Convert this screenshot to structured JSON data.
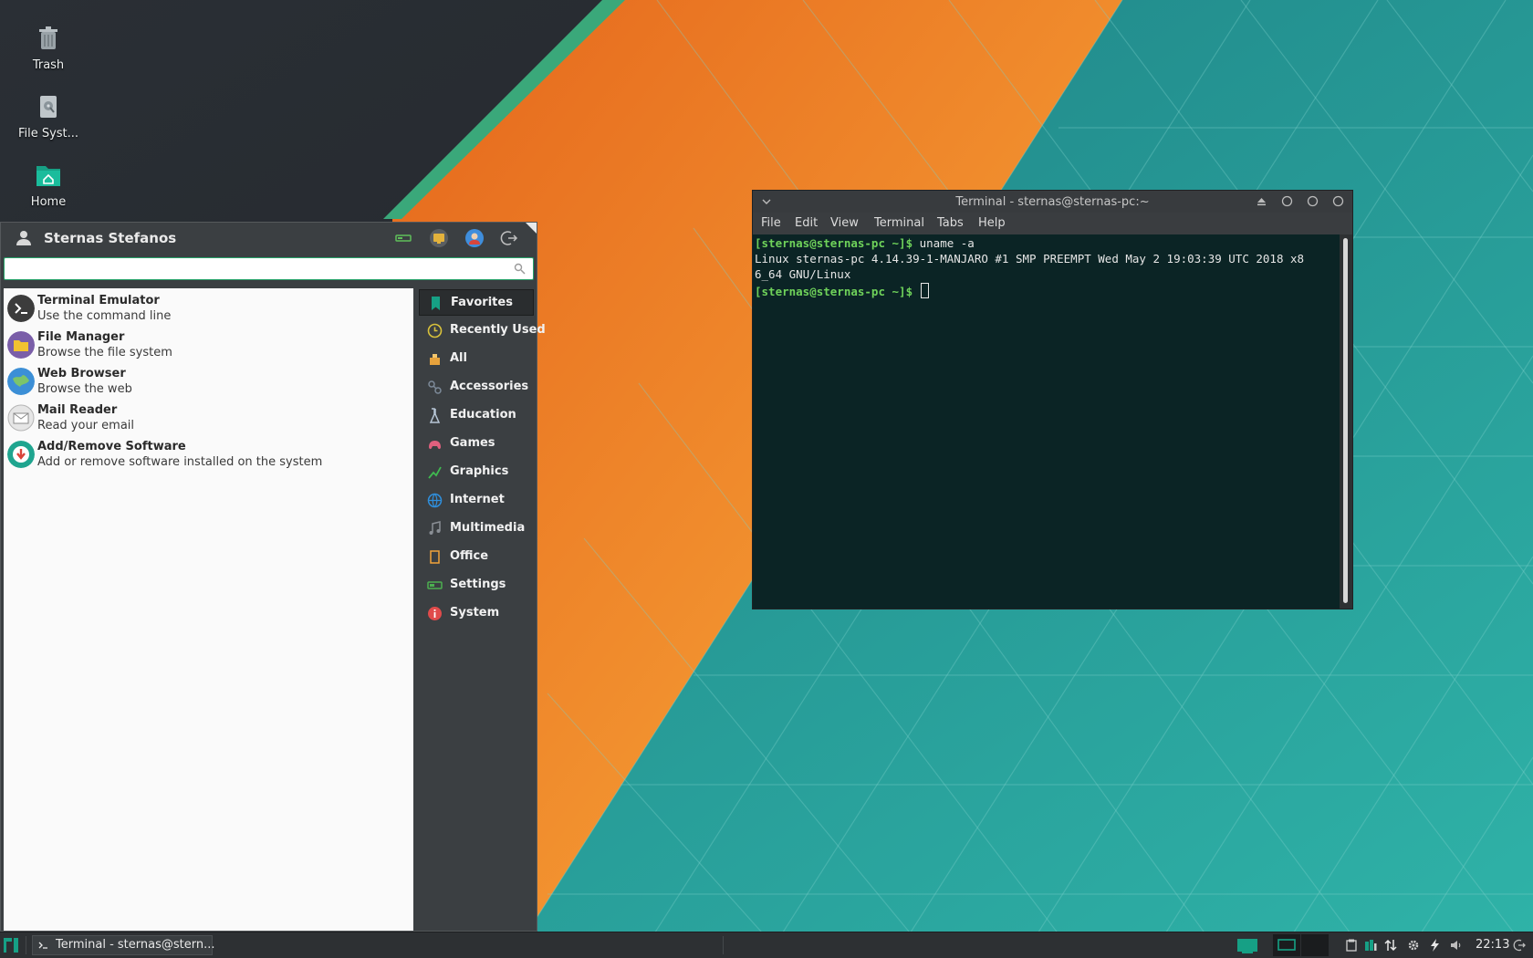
{
  "desktop": {
    "icons": [
      {
        "label": "Trash",
        "icon": "trash-icon"
      },
      {
        "label": "File Syst...",
        "icon": "filesystem-icon"
      },
      {
        "label": "Home",
        "icon": "home-folder-icon"
      }
    ]
  },
  "whisker_menu": {
    "user_name": "Sternas Stefanos",
    "search": {
      "value": "",
      "placeholder": ""
    },
    "header_buttons": [
      "settings-manager-icon",
      "lock-screen-icon",
      "switch-user-icon",
      "logout-icon"
    ],
    "apps": [
      {
        "name": "Terminal Emulator",
        "desc": "Use the command line",
        "icon": "terminal-icon",
        "color": "#3c3c3c"
      },
      {
        "name": "File Manager",
        "desc": "Browse the file system",
        "icon": "file-manager-icon",
        "color": "#7a5ea8"
      },
      {
        "name": "Web Browser",
        "desc": "Browse the web",
        "icon": "web-browser-icon",
        "color": "#3c8fd6"
      },
      {
        "name": "Mail Reader",
        "desc": "Read your email",
        "icon": "mail-icon",
        "color": "#d8d8d8"
      },
      {
        "name": "Add/Remove Software",
        "desc": "Add or remove software installed on the system",
        "icon": "software-icon",
        "color": "#1fa58f"
      }
    ],
    "categories": [
      {
        "label": "Favorites",
        "icon": "bookmark-icon",
        "color": "#16a085",
        "active": true
      },
      {
        "label": "Recently Used",
        "icon": "clock-icon",
        "color": "#d9c23b"
      },
      {
        "label": "All",
        "icon": "all-apps-icon",
        "color": "#e6a23c"
      },
      {
        "label": "Accessories",
        "icon": "accessories-icon",
        "color": "#7d8a99"
      },
      {
        "label": "Education",
        "icon": "education-icon",
        "color": "#b7c6d6"
      },
      {
        "label": "Games",
        "icon": "gamepad-icon",
        "color": "#e0607e"
      },
      {
        "label": "Graphics",
        "icon": "graphics-icon",
        "color": "#3fb950"
      },
      {
        "label": "Internet",
        "icon": "globe-icon",
        "color": "#2f8fdc"
      },
      {
        "label": "Multimedia",
        "icon": "music-icon",
        "color": "#8a8f95"
      },
      {
        "label": "Office",
        "icon": "office-icon",
        "color": "#f2a33a"
      },
      {
        "label": "Settings",
        "icon": "settings-icon",
        "color": "#4caf50"
      },
      {
        "label": "System",
        "icon": "info-icon",
        "color": "#e04b4b"
      }
    ]
  },
  "terminal": {
    "title": "Terminal - sternas@sternas-pc:~",
    "menu": [
      "File",
      "Edit",
      "View",
      "Terminal",
      "Tabs",
      "Help"
    ],
    "prompt": "[sternas@sternas-pc ~]$",
    "command": " uname -a",
    "output": [
      "Linux sternas-pc 4.14.39-1-MANJARO #1 SMP PREEMPT Wed May 2 19:03:39 UTC 2018 x8",
      "6_64 GNU/Linux"
    ]
  },
  "panel": {
    "task_label": "Terminal - sternas@stern...",
    "clock": "22:13",
    "tray": [
      "clipboard-icon",
      "battery-icon",
      "network-icon",
      "settings-tray-icon",
      "power-icon",
      "volume-icon",
      "logout-tray-icon"
    ]
  },
  "colors": {
    "accent": "#16a085",
    "prompt_green": "#6fd25a",
    "wallpaper_teal": "#2a9b9b",
    "wallpaper_orange": "#f39a2a"
  }
}
